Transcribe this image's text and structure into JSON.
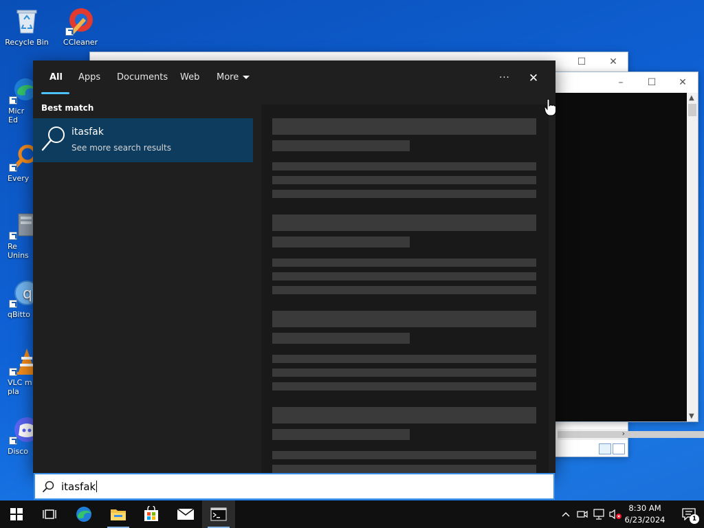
{
  "desktop": {
    "icons": [
      {
        "label": "Recycle Bin",
        "icon": "recycle-bin-icon"
      },
      {
        "label": "CCleaner",
        "icon": "ccleaner-icon"
      },
      {
        "label": "Micr\nEd",
        "icon": "edge-icon"
      },
      {
        "label": "Every",
        "icon": "everything-icon"
      },
      {
        "label": "Re\nUnins",
        "icon": "revo-uninstaller-icon"
      },
      {
        "label": "qBitto",
        "icon": "qbittorrent-icon"
      },
      {
        "label": "VLC m\npla",
        "icon": "vlc-icon"
      },
      {
        "label": "Disco",
        "icon": "discord-icon"
      }
    ]
  },
  "search": {
    "tabs": [
      {
        "label": "All",
        "active": true
      },
      {
        "label": "Apps"
      },
      {
        "label": "Documents"
      },
      {
        "label": "Web"
      },
      {
        "label": "More"
      }
    ],
    "more_options_label": "···",
    "close_label": "✕",
    "best_match_heading": "Best match",
    "best_match": {
      "title": "itasfak",
      "subtitle": "See more search results",
      "icon": "search-icon"
    },
    "query": "itasfak",
    "accent_color": "#4cc2ff",
    "selected_bg": "#0e3c5f"
  },
  "taskbar": {
    "time": "8:30 AM",
    "date": "6/23/2024",
    "notification_count": "1",
    "pinned": [
      "start-button",
      "task-view-button",
      "edge-icon",
      "file-explorer-icon",
      "microsoft-store-icon",
      "mail-icon",
      "terminal-icon"
    ]
  }
}
